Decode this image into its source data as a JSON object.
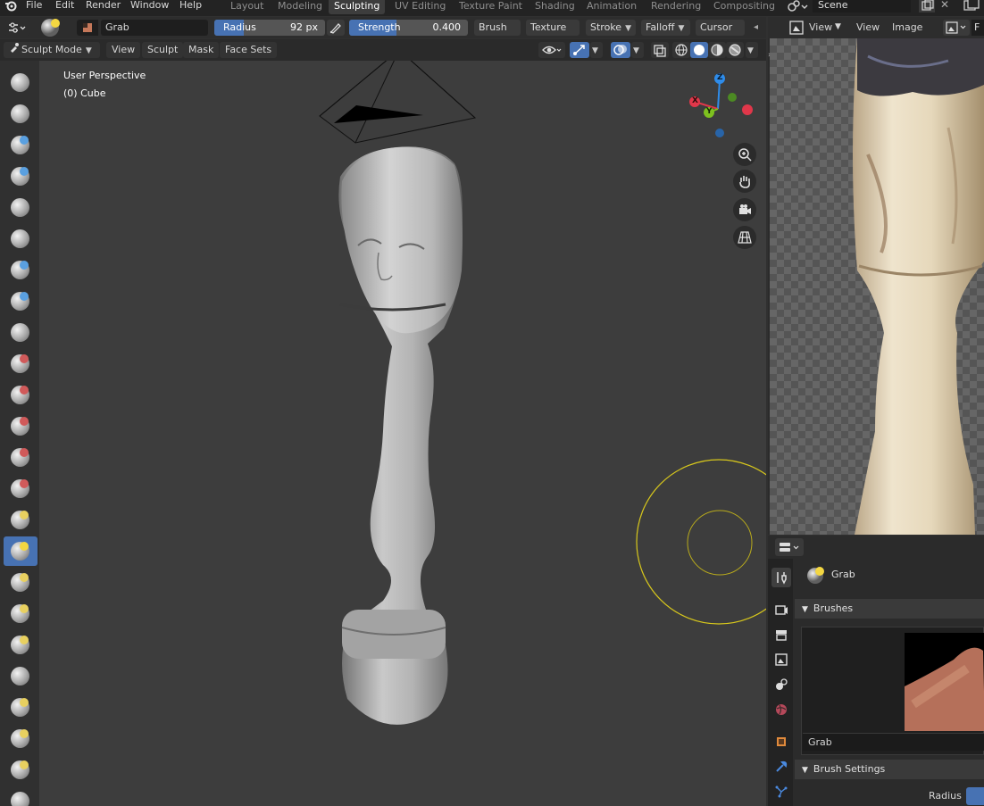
{
  "menubar": {
    "items": [
      "File",
      "Edit",
      "Render",
      "Window",
      "Help"
    ],
    "workspaces": [
      "Layout",
      "Modeling",
      "Sculpting",
      "UV Editing",
      "Texture Paint",
      "Shading",
      "Animation",
      "Rendering",
      "Compositing"
    ],
    "active_workspace": "Sculpting",
    "scene": "Scene"
  },
  "tool_header": {
    "brush_name": "Grab",
    "radius": {
      "label": "Radius",
      "value": "92 px",
      "fraction": 0.27
    },
    "strength": {
      "label": "Strength",
      "value": "0.400",
      "fraction": 0.4
    },
    "menus": [
      "Brush",
      "Texture",
      "Stroke",
      "Falloff",
      "Cursor"
    ]
  },
  "mode_header": {
    "mode": "Sculpt Mode",
    "menus": [
      "View",
      "Sculpt",
      "Mask",
      "Face Sets"
    ]
  },
  "viewport": {
    "perspective": "User Perspective",
    "object": "(0) Cube",
    "gizmo_axes": [
      "Z",
      "X",
      "Y"
    ],
    "colors": {
      "x": "#e0374a",
      "y": "#7ec11f",
      "z": "#2e8cea",
      "cursor": "#d8c81c"
    }
  },
  "toolbar": {
    "active_index": 15,
    "tools": [
      "draw-brush-icon",
      "draw-sharp-brush-icon",
      "clay-brush-icon",
      "clay-strips-brush-icon",
      "clay-thumb-brush-icon",
      "layer-brush-icon",
      "inflate-brush-icon",
      "blob-brush-icon",
      "crease-brush-icon",
      "smooth-brush-icon",
      "flatten-brush-icon",
      "fill-brush-icon",
      "scrape-brush-icon",
      "multiplane-scrape-brush-icon",
      "pinch-brush-icon",
      "grab-brush-icon",
      "elastic-deform-brush-icon",
      "snake-hook-brush-icon",
      "thumb-brush-icon",
      "pose-brush-icon",
      "nudge-brush-icon",
      "rotate-brush-icon",
      "slide-relax-brush-icon",
      "boundary-brush-icon"
    ]
  },
  "image_editor": {
    "menus": [
      "View",
      "View",
      "Image"
    ]
  },
  "properties": {
    "brush_name": "Grab",
    "brushes_panel": "Brushes",
    "preview_name": "Grab",
    "brush_settings_panel": "Brush Settings",
    "radius_label": "Radius"
  }
}
